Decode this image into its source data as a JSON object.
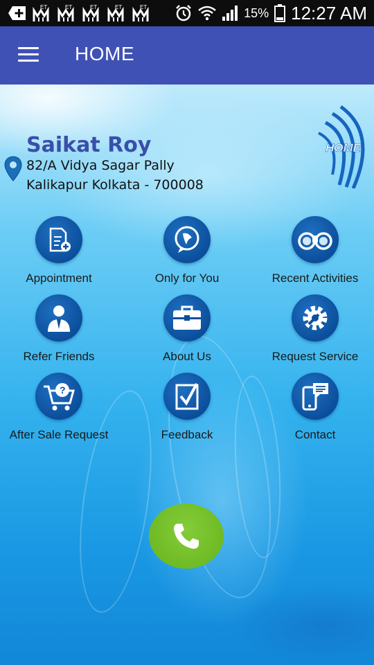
{
  "status_bar": {
    "battery_percent": "15%",
    "time": "12:27 AM",
    "notification_badge": "ET"
  },
  "app_bar": {
    "title": "HOME"
  },
  "profile": {
    "name": "Saikat Roy",
    "address_line1": "82/A Vidya Sagar Pally",
    "address_line2": "Kalikapur  Kolkata - 700008"
  },
  "logo": {
    "text": "HOME"
  },
  "menu": [
    {
      "label": "Appointment",
      "icon": "appointment-icon"
    },
    {
      "label": "Only for You",
      "icon": "chat-bubble-icon"
    },
    {
      "label": "Recent Activities",
      "icon": "binoculars-icon"
    },
    {
      "label": "Refer Friends",
      "icon": "person-icon"
    },
    {
      "label": "About Us",
      "icon": "briefcase-icon"
    },
    {
      "label": "Request Service",
      "icon": "gear-wrench-icon"
    },
    {
      "label": "After Sale Request",
      "icon": "cart-question-icon"
    },
    {
      "label": "Feedback",
      "icon": "checkbox-icon"
    },
    {
      "label": "Contact",
      "icon": "phone-message-icon"
    }
  ],
  "colors": {
    "app_bar": "#3f51b5",
    "name": "#3a4fa8",
    "icon_circle": "#0b4f9c",
    "call_button": "#6fbb24"
  }
}
